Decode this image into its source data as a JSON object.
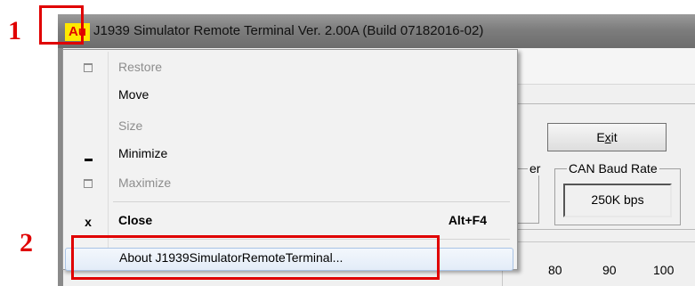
{
  "annotations": {
    "step1": "1",
    "step2": "2"
  },
  "window": {
    "icon_text": "Au",
    "title": "J1939 Simulator Remote Terminal Ver. 2.00A (Build 07182016-02)",
    "exit_button": "Exit",
    "left_group_label_fragment": "er",
    "baud_group_label": "CAN Baud Rate",
    "baud_value": "250K bps",
    "scale_labels": [
      "80",
      "90",
      "100"
    ]
  },
  "system_menu": {
    "items": [
      {
        "label": "Restore",
        "icon": "restore-icon",
        "enabled": false
      },
      {
        "label": "Move",
        "icon": "",
        "enabled": true
      },
      {
        "label": "Size",
        "icon": "",
        "enabled": false
      },
      {
        "label": "Minimize",
        "icon": "minimize-icon",
        "enabled": true
      },
      {
        "label": "Maximize",
        "icon": "maximize-icon",
        "enabled": false
      },
      {
        "label": "Close",
        "icon": "close-icon",
        "icon_glyph": "x",
        "shortcut": "Alt+F4",
        "enabled": true
      },
      {
        "label": "About J1939SimulatorRemoteTerminal...",
        "icon": "",
        "enabled": true,
        "highlighted": true
      }
    ]
  },
  "colors": {
    "annotation_red": "#e00000",
    "icon_yellow": "#ffe800",
    "menu_highlight_border": "#a9c3e5"
  }
}
